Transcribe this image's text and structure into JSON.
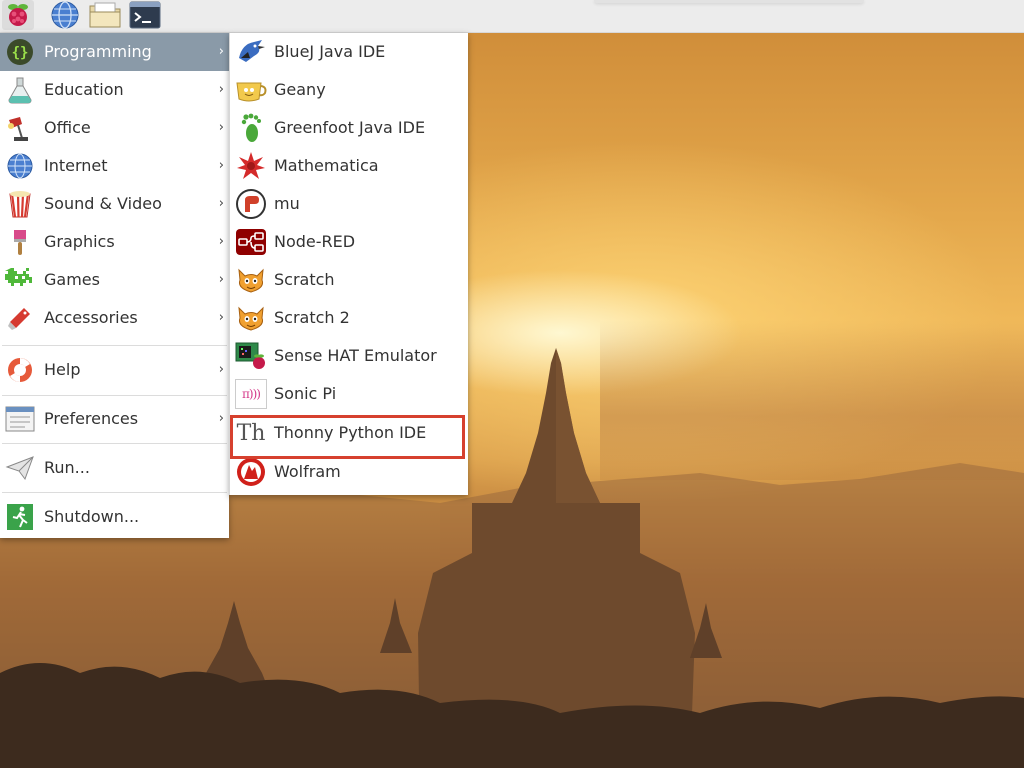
{
  "taskbar": {
    "icons": [
      "raspberry-menu-icon",
      "web-browser-icon",
      "file-manager-icon",
      "terminal-icon"
    ]
  },
  "main_menu": {
    "items": [
      {
        "label": "Programming",
        "icon": "programming-icon",
        "has_submenu": true
      },
      {
        "label": "Education",
        "icon": "education-icon",
        "has_submenu": true
      },
      {
        "label": "Office",
        "icon": "office-icon",
        "has_submenu": true
      },
      {
        "label": "Internet",
        "icon": "internet-icon",
        "has_submenu": true
      },
      {
        "label": "Sound & Video",
        "icon": "sound-video-icon",
        "has_submenu": true
      },
      {
        "label": "Graphics",
        "icon": "graphics-icon",
        "has_submenu": true
      },
      {
        "label": "Games",
        "icon": "games-icon",
        "has_submenu": true
      },
      {
        "label": "Accessories",
        "icon": "accessories-icon",
        "has_submenu": true
      },
      {
        "label": "Help",
        "icon": "help-icon",
        "has_submenu": true
      },
      {
        "label": "Preferences",
        "icon": "preferences-icon",
        "has_submenu": true
      },
      {
        "label": "Run...",
        "icon": "run-icon",
        "has_submenu": false
      },
      {
        "label": "Shutdown...",
        "icon": "shutdown-icon",
        "has_submenu": false
      }
    ],
    "arrow": "›",
    "active": "Programming"
  },
  "programming_submenu": {
    "items": [
      {
        "label": "BlueJ Java IDE",
        "icon": "bluej-icon"
      },
      {
        "label": "Geany",
        "icon": "geany-icon"
      },
      {
        "label": "Greenfoot Java IDE",
        "icon": "greenfoot-icon"
      },
      {
        "label": "Mathematica",
        "icon": "mathematica-icon"
      },
      {
        "label": "mu",
        "icon": "mu-icon"
      },
      {
        "label": "Node-RED",
        "icon": "node-red-icon"
      },
      {
        "label": "Scratch",
        "icon": "scratch-icon"
      },
      {
        "label": "Scratch 2",
        "icon": "scratch2-icon"
      },
      {
        "label": "Sense HAT Emulator",
        "icon": "sense-hat-icon"
      },
      {
        "label": "Sonic Pi",
        "icon": "sonic-pi-icon"
      },
      {
        "label": "Thonny Python IDE",
        "icon": "thonny-icon"
      },
      {
        "label": "Wolfram",
        "icon": "wolfram-icon"
      }
    ],
    "highlighted": "Thonny Python IDE",
    "sonic_pi_glyph": "π)))",
    "thonny_glyph": "Th"
  },
  "colors": {
    "active_item_bg": "#8a9aa8",
    "highlight_border": "#d6402e",
    "taskbar_bg": "#ececec"
  }
}
